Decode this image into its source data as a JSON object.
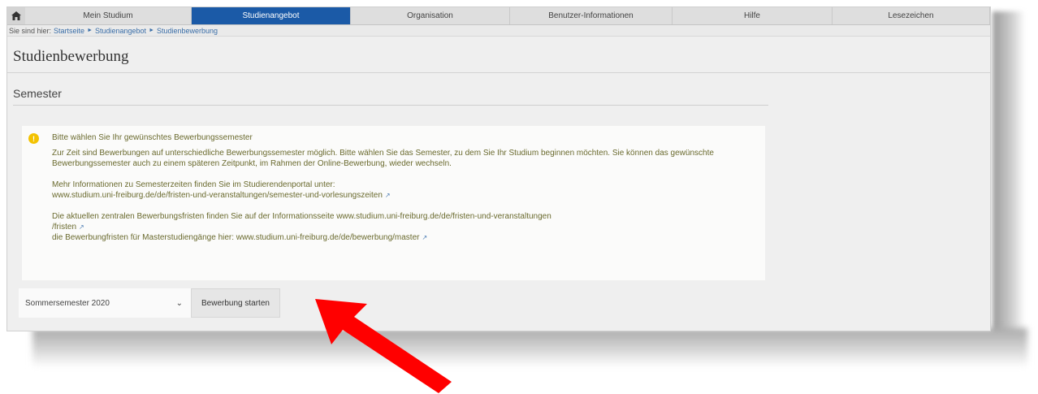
{
  "nav": {
    "items": [
      "Mein Studium",
      "Studienangebot",
      "Organisation",
      "Benutzer-Informationen",
      "Hilfe",
      "Lesezeichen"
    ],
    "active": "Studienangebot",
    "active_color": "#1b5aa7"
  },
  "breadcrumb": {
    "prefix": "Sie sind hier:",
    "items": [
      "Startseite",
      "Studienangebot",
      "Studienbewerbung"
    ]
  },
  "page": {
    "title": "Studienbewerbung"
  },
  "section": {
    "title": "Semester"
  },
  "info": {
    "icon": "info-icon",
    "headline": "Bitte wählen Sie Ihr gewünschtes Bewerbungssemester",
    "para1": "Zur Zeit sind Bewerbungen auf unterschiedliche Bewerbungssemester möglich. Bitte wählen Sie das Semester, zu dem Sie Ihr Studium beginnen möchten. Sie können das gewünschte Bewerbungssemester auch zu einem späteren Zeitpunkt, im Rahmen der Online-Bewerbung, wieder wechseln.",
    "para2_line1": "Mehr Informationen zu Semesterzeiten finden Sie im Studierendenportal unter:",
    "para2_link": "www.studium.uni-freiburg.de/de/fristen-und-veranstaltungen/semester-und-vorlesungszeiten",
    "para3_line1": "Die aktuellen zentralen Bewerbungsfristen finden Sie auf der Informationsseite www.studium.uni-freiburg.de/de/fristen-und-veranstaltungen",
    "para3_line2": "/fristen",
    "para3_line3": "die Bewerbungfristen für Masterstudiengänge hier: www.studium.uni-freiburg.de/de/bewerbung/master"
  },
  "controls": {
    "semester_selected": "Sommersemester 2020",
    "start_label": "Bewerbung starten"
  },
  "annotation": {
    "arrow_color": "#ff0000"
  }
}
